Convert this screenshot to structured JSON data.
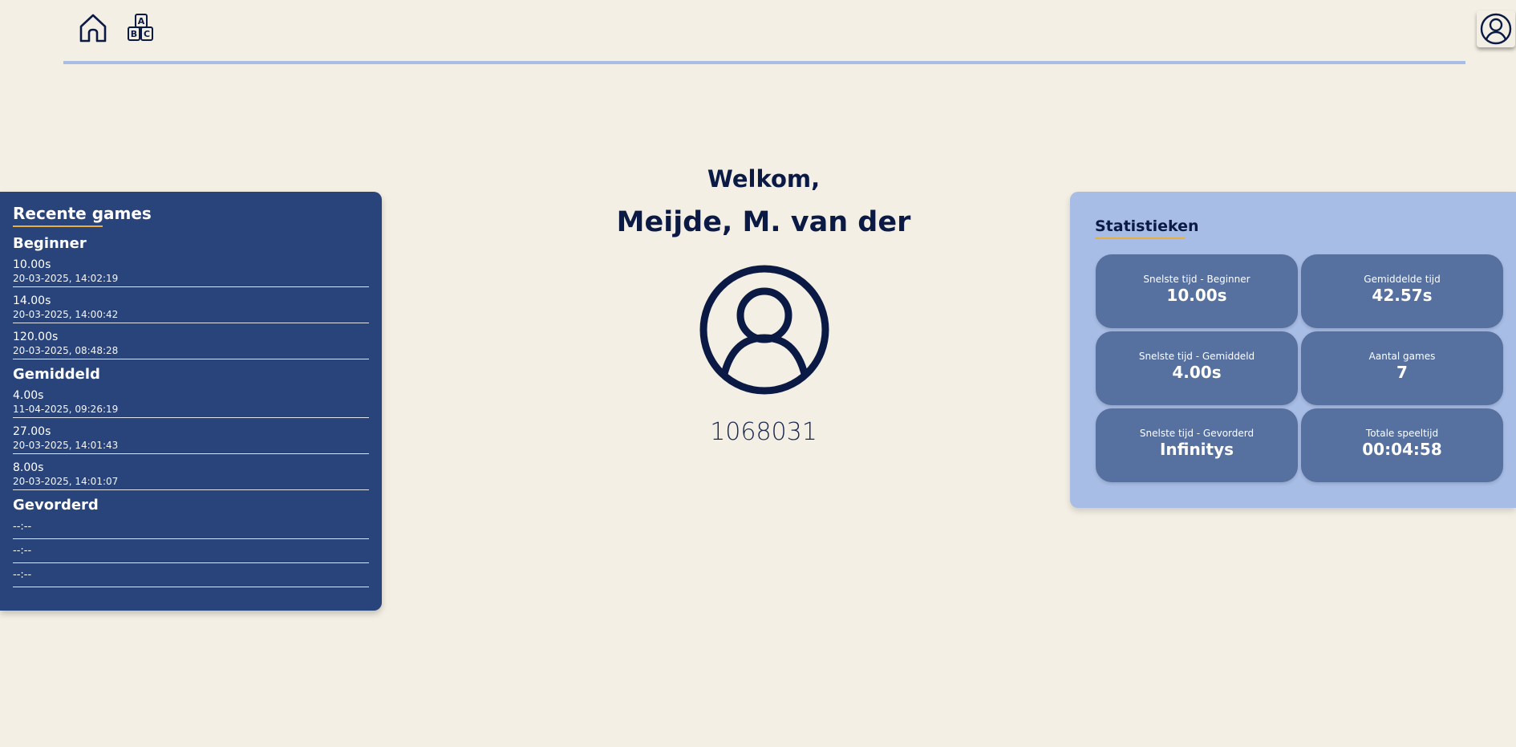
{
  "header": {
    "home_icon": "home-icon",
    "abc_icon": "abc-blocks-icon",
    "abc_letters": [
      "A",
      "B",
      "C"
    ],
    "profile_icon": "user-circle-icon"
  },
  "welcome": {
    "greeting": "Welkom,",
    "name": "Meijde, M. van der",
    "avatar_icon": "user-circle-icon",
    "student_number": "1068031"
  },
  "recent_games": {
    "title": "Recente games",
    "levels": [
      {
        "name": "Beginner",
        "entries": [
          {
            "time": "10.00s",
            "date": "20-03-2025, 14:02:19"
          },
          {
            "time": "14.00s",
            "date": "20-03-2025, 14:00:42"
          },
          {
            "time": "120.00s",
            "date": "20-03-2025, 08:48:28"
          }
        ]
      },
      {
        "name": "Gemiddeld",
        "entries": [
          {
            "time": "4.00s",
            "date": "11-04-2025, 09:26:19"
          },
          {
            "time": "27.00s",
            "date": "20-03-2025, 14:01:43"
          },
          {
            "time": "8.00s",
            "date": "20-03-2025, 14:01:07"
          }
        ]
      },
      {
        "name": "Gevorderd",
        "empty_entries": [
          "--:--",
          "--:--",
          "--:--"
        ]
      }
    ]
  },
  "statistics": {
    "title": "Statistieken",
    "cards": [
      {
        "label": "Snelste tijd - Beginner",
        "value": "10.00s"
      },
      {
        "label": "Gemiddelde tijd",
        "value": "42.57s"
      },
      {
        "label": "Snelste tijd - Gemiddeld",
        "value": "4.00s"
      },
      {
        "label": "Aantal games",
        "value": "7"
      },
      {
        "label": "Snelste tijd - Gevorderd",
        "value": "Infinitys"
      },
      {
        "label": "Totale speeltijd",
        "value": "00:04:58"
      }
    ]
  },
  "colors": {
    "background": "#f3efe4",
    "navy": "#0b1a45",
    "panel_dark": "#29447a",
    "panel_light": "#a8bde6",
    "card": "#56709f",
    "accent": "#e8b03a"
  }
}
